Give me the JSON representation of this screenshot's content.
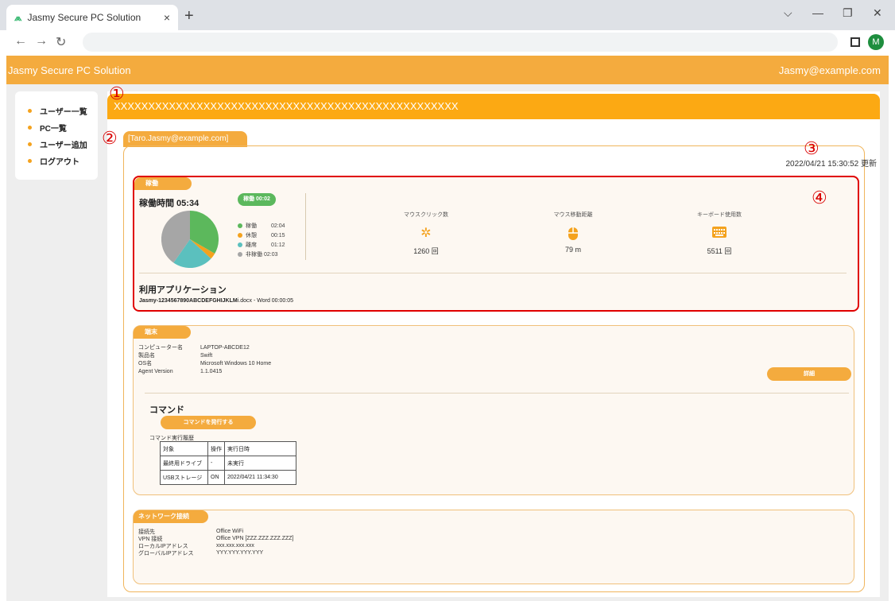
{
  "browser": {
    "tab_title": "Jasmy Secure PC Solution",
    "tab_close": "×",
    "new_tab": "+",
    "profile_initial": "M"
  },
  "header": {
    "brand": "Jasmy Secure PC Solution",
    "user_email": "Jasmy@example.com"
  },
  "sidebar": {
    "items": [
      {
        "label": "ユーザー一覧"
      },
      {
        "label": "PC一覧"
      },
      {
        "label": "ユーザー追加"
      },
      {
        "label": "ログアウト"
      }
    ]
  },
  "annotations": {
    "n1": "①",
    "n2": "②",
    "n3": "③",
    "n4": "④"
  },
  "main": {
    "banner_text": "XXXXXXXXXXXXXXXXXXXXXXXXXXXXXXXXXXXXXXXXXXXXXXXXXX",
    "user_tab": "[Taro.Jasmy@example.com]",
    "updated": "2022/04/21 15:30:52 更新"
  },
  "operation": {
    "tab_label": "稼働",
    "time_label": "稼働時間 05:34",
    "badge": "稼働 00:02",
    "legend": [
      {
        "label": "稼働",
        "value": "02:04",
        "color": "#5cb85c"
      },
      {
        "label": "休憩",
        "value": "00:15",
        "color": "#f4a21e"
      },
      {
        "label": "離席",
        "value": "01:12",
        "color": "#5bc0be"
      },
      {
        "label": "非稼働",
        "value": "02:03",
        "color": "#a6a6a6"
      }
    ],
    "metrics": [
      {
        "label": "マウスクリック数",
        "icon": "click-icon",
        "value": "1260 回"
      },
      {
        "label": "マウス移動距離",
        "icon": "mouse-icon",
        "value": "79 m"
      },
      {
        "label": "キーボード使用数",
        "icon": "keyboard-icon",
        "value": "5511 回"
      }
    ],
    "apps_title": "利用アプリケーション",
    "app_name": "Jasmy-1234567890ABCDEFGHIJKLM",
    "app_rest": "i.docx - Word  00:00:05"
  },
  "terminal": {
    "tab_label": "端末",
    "rows": [
      {
        "k": "コンピューター名",
        "v": "LAPTOP-ABCDE12"
      },
      {
        "k": "製品名",
        "v": "Swift"
      },
      {
        "k": "OS名",
        "v": "Microsoft Windows 10 Home"
      },
      {
        "k": "Agent Version",
        "v": "1.1.0415"
      }
    ],
    "detail_button": "詳細",
    "command_title": "コマンド",
    "command_button": "コマンドを発行する",
    "history_title": "コマンド実行履歴",
    "history": [
      [
        "対象",
        "操作",
        "実行日時"
      ],
      [
        "最終用ドライブ",
        "-",
        "未実行"
      ],
      [
        "USBストレージ",
        "ON",
        "2022/04/21 11:34:30"
      ]
    ]
  },
  "network": {
    "tab_label": "ネットワーク接続",
    "rows": [
      {
        "k": "接続先",
        "v": "Office WiFi"
      },
      {
        "k": "VPN 接続",
        "v": "Office VPN [ZZZ.ZZZ.ZZZ.ZZZ]"
      },
      {
        "k": "ローカルIPアドレス",
        "v": "xxx.xxx.xxx.xxx"
      },
      {
        "k": "グローバルIPアドレス",
        "v": "YYY.YYY.YYY.YYY"
      }
    ]
  }
}
